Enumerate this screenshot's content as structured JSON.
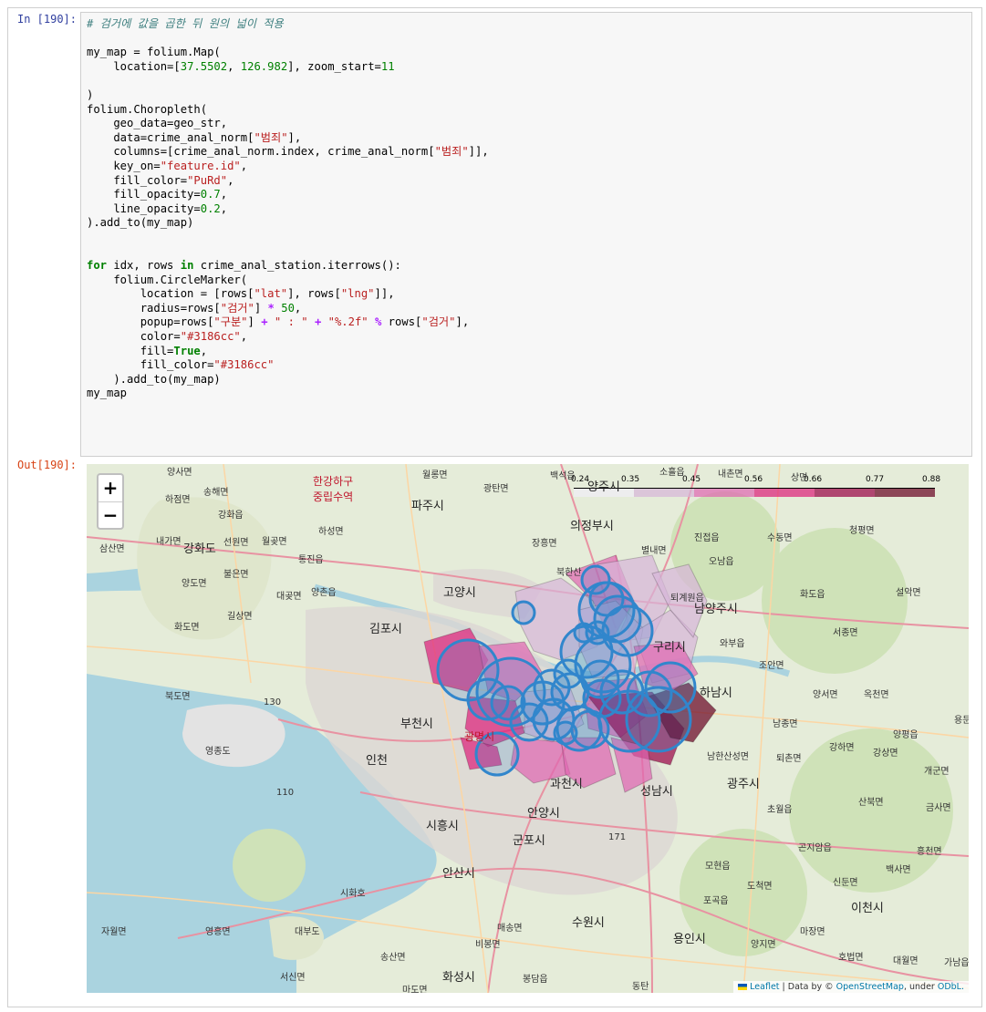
{
  "cell": {
    "in_prompt": "In [190]:",
    "out_prompt": "Out[190]:"
  },
  "code_lines": [
    [
      {
        "t": "# 검거에 값을 곱한 뒤 원의 넓이 적용",
        "c": "cm"
      }
    ],
    [],
    [
      {
        "t": "my_map = folium.Map("
      }
    ],
    [
      {
        "t": "    location=["
      },
      {
        "t": "37.5502",
        "c": "nm"
      },
      {
        "t": ", "
      },
      {
        "t": "126.982",
        "c": "nm"
      },
      {
        "t": "], zoom_start="
      },
      {
        "t": "11",
        "c": "nm"
      }
    ],
    [],
    [
      {
        "t": ")"
      }
    ],
    [
      {
        "t": "folium.Choropleth("
      }
    ],
    [
      {
        "t": "    geo_data=geo_str,"
      }
    ],
    [
      {
        "t": "    data=crime_anal_norm["
      },
      {
        "t": "\"범죄\"",
        "c": "st"
      },
      {
        "t": "],"
      }
    ],
    [
      {
        "t": "    columns=[crime_anal_norm.index, crime_anal_norm["
      },
      {
        "t": "\"범죄\"",
        "c": "st"
      },
      {
        "t": "]],"
      }
    ],
    [
      {
        "t": "    key_on="
      },
      {
        "t": "\"feature.id\"",
        "c": "st"
      },
      {
        "t": ","
      }
    ],
    [
      {
        "t": "    fill_color="
      },
      {
        "t": "\"PuRd\"",
        "c": "st"
      },
      {
        "t": ","
      }
    ],
    [
      {
        "t": "    fill_opacity="
      },
      {
        "t": "0.7",
        "c": "nm"
      },
      {
        "t": ","
      }
    ],
    [
      {
        "t": "    line_opacity="
      },
      {
        "t": "0.2",
        "c": "nm"
      },
      {
        "t": ","
      }
    ],
    [
      {
        "t": ").add_to(my_map)"
      }
    ],
    [],
    [],
    [
      {
        "t": "for",
        "c": "kw"
      },
      {
        "t": " idx, rows "
      },
      {
        "t": "in",
        "c": "kw"
      },
      {
        "t": " crime_anal_station.iterrows():"
      }
    ],
    [
      {
        "t": "    folium.CircleMarker("
      }
    ],
    [
      {
        "t": "        location = [rows["
      },
      {
        "t": "\"lat\"",
        "c": "st"
      },
      {
        "t": "], rows["
      },
      {
        "t": "\"lng\"",
        "c": "st"
      },
      {
        "t": "]],"
      }
    ],
    [
      {
        "t": "        radius=rows["
      },
      {
        "t": "\"검거\"",
        "c": "st"
      },
      {
        "t": "] "
      },
      {
        "t": "*",
        "c": "op"
      },
      {
        "t": " "
      },
      {
        "t": "50",
        "c": "nm"
      },
      {
        "t": ","
      }
    ],
    [
      {
        "t": "        popup=rows["
      },
      {
        "t": "\"구분\"",
        "c": "st"
      },
      {
        "t": "] "
      },
      {
        "t": "+",
        "c": "op"
      },
      {
        "t": " "
      },
      {
        "t": "\" : \"",
        "c": "st"
      },
      {
        "t": " "
      },
      {
        "t": "+",
        "c": "op"
      },
      {
        "t": " "
      },
      {
        "t": "\"%.2f\"",
        "c": "st"
      },
      {
        "t": " "
      },
      {
        "t": "%",
        "c": "op"
      },
      {
        "t": " rows["
      },
      {
        "t": "\"검거\"",
        "c": "st"
      },
      {
        "t": "],"
      }
    ],
    [
      {
        "t": "        color="
      },
      {
        "t": "\"#3186cc\"",
        "c": "st"
      },
      {
        "t": ","
      }
    ],
    [
      {
        "t": "        fill="
      },
      {
        "t": "True",
        "c": "kw"
      },
      {
        "t": ","
      }
    ],
    [
      {
        "t": "        fill_color="
      },
      {
        "t": "\"#3186cc\"",
        "c": "st"
      }
    ],
    [
      {
        "t": "    ).add_to(my_map)"
      }
    ],
    [
      {
        "t": "my_map"
      }
    ]
  ],
  "map": {
    "zoom_in": "+",
    "zoom_out": "−",
    "legend_ticks": [
      "0.24",
      "0.35",
      "0.45",
      "0.56",
      "0.66",
      "0.77",
      "0.88"
    ],
    "legend_colors": [
      "#f1eef6",
      "#d7b5d8",
      "#df65b0",
      "#dd1c77",
      "#980043",
      "#67001f"
    ],
    "circle_color": "#3186cc",
    "places": [
      {
        "name": "양사면"
      },
      {
        "name": "하점면"
      },
      {
        "name": "송해면"
      },
      {
        "name": "강화읍"
      },
      {
        "name": "내가면"
      },
      {
        "name": "강화도"
      },
      {
        "name": "선원면"
      },
      {
        "name": "월곶면"
      },
      {
        "name": "하성면"
      },
      {
        "name": "삼산면"
      },
      {
        "name": "불은면"
      },
      {
        "name": "양도면"
      },
      {
        "name": "길상면"
      },
      {
        "name": "화도면"
      },
      {
        "name": "대곶면"
      },
      {
        "name": "양촌읍"
      },
      {
        "name": "통진읍"
      },
      {
        "name": "김포시"
      },
      {
        "name": "한강하구"
      },
      {
        "name": "중립수역"
      },
      {
        "name": "월롱면"
      },
      {
        "name": "광탄면"
      },
      {
        "name": "파주시"
      },
      {
        "name": "백석읍"
      },
      {
        "name": "양주시"
      },
      {
        "name": "소흘읍"
      },
      {
        "name": "내촌면"
      },
      {
        "name": "상면"
      },
      {
        "name": "의정부시"
      },
      {
        "name": "장흥면"
      },
      {
        "name": "진접읍"
      },
      {
        "name": "수동면"
      },
      {
        "name": "청평면"
      },
      {
        "name": "별내면"
      },
      {
        "name": "오남읍"
      },
      {
        "name": "고양시"
      },
      {
        "name": "북한산"
      },
      {
        "name": "퇴계원읍"
      },
      {
        "name": "남양주시"
      },
      {
        "name": "화도읍"
      },
      {
        "name": "설악면"
      },
      {
        "name": "와부읍"
      },
      {
        "name": "서종면"
      },
      {
        "name": "구리시"
      },
      {
        "name": "조안면"
      },
      {
        "name": "하남시"
      },
      {
        "name": "양서면"
      },
      {
        "name": "옥천면"
      },
      {
        "name": "용문"
      },
      {
        "name": "북도면"
      },
      {
        "name": "130"
      },
      {
        "name": "영종도"
      },
      {
        "name": "부천시"
      },
      {
        "name": "광명시"
      },
      {
        "name": "인천"
      },
      {
        "name": "남종면"
      },
      {
        "name": "퇴촌면"
      },
      {
        "name": "강하면"
      },
      {
        "name": "강상면"
      },
      {
        "name": "양평읍"
      },
      {
        "name": "개군면"
      },
      {
        "name": "남한산성면"
      },
      {
        "name": "광주시"
      },
      {
        "name": "과천시"
      },
      {
        "name": "성남시"
      },
      {
        "name": "110"
      },
      {
        "name": "산북면"
      },
      {
        "name": "금사면"
      },
      {
        "name": "초월읍"
      },
      {
        "name": "안양시"
      },
      {
        "name": "시흥시"
      },
      {
        "name": "군포시"
      },
      {
        "name": "171"
      },
      {
        "name": "곤지암읍"
      },
      {
        "name": "흥천면"
      },
      {
        "name": "모현읍"
      },
      {
        "name": "백사면"
      },
      {
        "name": "안산시"
      },
      {
        "name": "도척면"
      },
      {
        "name": "신둔면"
      },
      {
        "name": "시화호"
      },
      {
        "name": "포곡읍"
      },
      {
        "name": "이천시"
      },
      {
        "name": "자월면"
      },
      {
        "name": "영흥면"
      },
      {
        "name": "대부도"
      },
      {
        "name": "매송면"
      },
      {
        "name": "수원시"
      },
      {
        "name": "용인시"
      },
      {
        "name": "양지면"
      },
      {
        "name": "마장면"
      },
      {
        "name": "비봉면"
      },
      {
        "name": "송산면"
      },
      {
        "name": "호법면"
      },
      {
        "name": "대월면"
      },
      {
        "name": "가남읍"
      },
      {
        "name": "서신면"
      },
      {
        "name": "마도면"
      },
      {
        "name": "화성시"
      },
      {
        "name": "봉담읍"
      },
      {
        "name": "동탄"
      }
    ],
    "attribution": {
      "leaflet": "Leaflet",
      "data_by": " | Data by © ",
      "osm": "OpenStreetMap",
      "under": ", under ",
      "odbl": "ODbL."
    }
  }
}
